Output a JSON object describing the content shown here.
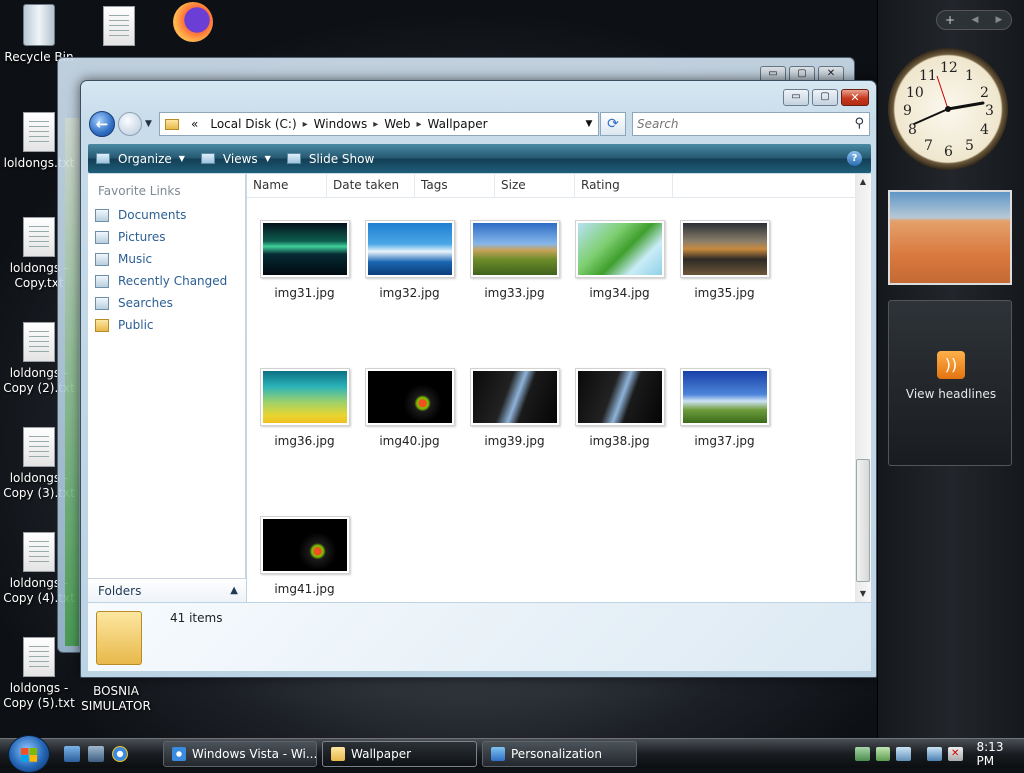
{
  "desktop": {
    "recycle_bin": "Recycle Bin",
    "icons": [
      "loldongs.txt",
      "loldongs - Copy.txt",
      "loldongs - Copy (2).txt",
      "loldongs - Copy (3).txt",
      "loldongs - Copy (4).txt",
      "loldongs - Copy (5).txt",
      "BOSNIA SIMULATOR"
    ]
  },
  "window": {
    "controls": {
      "minimize": "▭",
      "maximize": "▢",
      "close": "✕"
    },
    "address": {
      "chevron": "«",
      "segments": [
        "Local Disk (C:)",
        "Windows",
        "Web",
        "Wallpaper"
      ],
      "separator": "▸"
    },
    "search": {
      "placeholder": "Search"
    },
    "toolbar": {
      "organize": "Organize",
      "views": "Views",
      "slideshow": "Slide Show",
      "help": "?"
    },
    "nav": {
      "header": "Favorite Links",
      "items": [
        "Documents",
        "Pictures",
        "Music",
        "Recently Changed",
        "Searches",
        "Public"
      ],
      "folders": "Folders"
    },
    "columns": [
      "Name",
      "Date taken",
      "Tags",
      "Size",
      "Rating"
    ],
    "files": [
      {
        "name": "img31.jpg",
        "style": "aurora"
      },
      {
        "name": "img32.jpg",
        "style": "fish"
      },
      {
        "name": "img33.jpg",
        "style": "hills"
      },
      {
        "name": "img34.jpg",
        "style": "palm"
      },
      {
        "name": "img35.jpg",
        "style": "rocks"
      },
      {
        "name": "img36.jpg",
        "style": "aurora2"
      },
      {
        "name": "img40.jpg",
        "style": "vista"
      },
      {
        "name": "img39.jpg",
        "style": "dark"
      },
      {
        "name": "img38.jpg",
        "style": "dark"
      },
      {
        "name": "img37.jpg",
        "style": "tree"
      },
      {
        "name": "img41.jpg",
        "style": "vista"
      }
    ],
    "details": {
      "count": "41 items"
    }
  },
  "gadgets": {
    "add": "+",
    "clock_numbers": [
      "12",
      "1",
      "2",
      "3",
      "4",
      "5",
      "6",
      "7",
      "8",
      "9",
      "10",
      "11"
    ],
    "headlines": "View headlines"
  },
  "taskbar": {
    "tasks": [
      "Windows Vista - Wi...",
      "Wallpaper",
      "Personalization"
    ],
    "clock": "8:13 PM"
  },
  "colors": {
    "accent": "#24566f",
    "link": "#2b5f94"
  }
}
